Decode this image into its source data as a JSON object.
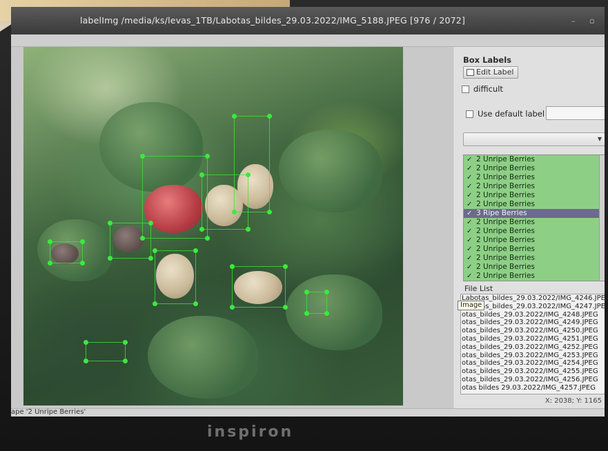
{
  "window": {
    "title": "labelImg /media/ks/levas_1TB/Labotas_bildes_29.03.2022/IMG_5188.JPEG [976 / 2072]"
  },
  "dock": {
    "title": "Box Labels",
    "edit_label_button": "Edit Label",
    "difficult_label": "difficult",
    "use_default_label": "Use default label",
    "default_label_value": "",
    "combo_value": ""
  },
  "labels": [
    "2 Unripe Berries",
    "2 Unripe Berries",
    "2 Unripe Berries",
    "2 Unripe Berries",
    "2 Unripe Berries",
    "2 Unripe Berries",
    "3 Ripe Berries",
    "2 Unripe Berries",
    "2 Unripe Berries",
    "2 Unripe Berries",
    "2 Unripe Berries",
    "2 Unripe Berries",
    "2 Unripe Berries",
    "2 Unripe Berries"
  ],
  "selected_label_index": 6,
  "file_list": {
    "title": "File List",
    "tooltip": "Image",
    "files": [
      "Labotas_bildes_29.03.2022/IMG_4246.JPEG",
      "Labotas_bildes_29.03.2022/IMG_4247.JPEG",
      "otas_bildes_29.03.2022/IMG_4248.JPEG",
      "otas_bildes_29.03.2022/IMG_4249.JPEG",
      "otas_bildes_29.03.2022/IMG_4250.JPEG",
      "otas_bildes_29.03.2022/IMG_4251.JPEG",
      "otas_bildes_29.03.2022/IMG_4252.JPEG",
      "otas_bildes_29.03.2022/IMG_4253.JPEG",
      "otas_bildes_29.03.2022/IMG_4254.JPEG",
      "otas_bildes_29.03.2022/IMG_4255.JPEG",
      "otas_bildes_29.03.2022/IMG_4256.JPEG",
      "otas bildes 29.03.2022/IMG_4257.JPEG"
    ]
  },
  "coords": "X: 2038; Y: 1165",
  "status": "ape '2 Unripe Berries'",
  "laptop_brand": "inspiron",
  "colors": {
    "label_bg": "#8ecf86",
    "selected_bg": "#6c6a8e",
    "box_point": "#3cea3c"
  }
}
